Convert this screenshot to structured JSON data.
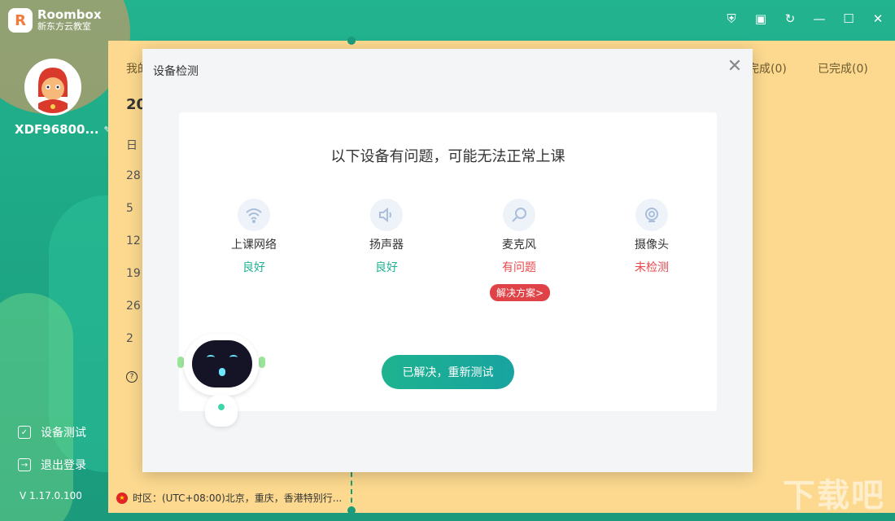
{
  "app": {
    "logo_mark": "R",
    "name": "Roombox",
    "subtitle": "新东方云教室"
  },
  "window_controls": {
    "shield": "⛨",
    "calendar": "▣",
    "refresh": "↻",
    "minimize": "—",
    "maximize": "☐",
    "close": "✕"
  },
  "sidebar": {
    "username": "XDF96800...",
    "edit_icon": "✎",
    "device_test_label": "设备测试",
    "device_test_icon": "✓",
    "logout_label": "退出登录",
    "logout_icon": "→",
    "version": "V 1.17.0.100"
  },
  "main": {
    "tab_my": "我的",
    "tab_unfinished": "未完成(0)",
    "tab_finished": "已完成(0)",
    "year": "20",
    "weekday": "日",
    "dates": [
      "28",
      "5",
      "12",
      "19",
      "26",
      "2"
    ],
    "help_icon": "?",
    "flag_star": "★",
    "timezone": "时区：(UTC+08:00)北京，重庆，香港特别行..."
  },
  "modal": {
    "title": "设备检测",
    "close_icon": "✕",
    "heading": "以下设备有问题，可能无法正常上课",
    "devices": [
      {
        "name": "上课网络",
        "status": "良好",
        "icon": "◠"
      },
      {
        "name": "扬声器",
        "status": "良好",
        "icon": "◁"
      },
      {
        "name": "麦克风",
        "status": "有问题",
        "icon": "◯"
      },
      {
        "name": "摄像头",
        "status": "未检测",
        "icon": "◉"
      }
    ],
    "solution_label": "解决方案>",
    "retest_label": "已解决，重新测试"
  },
  "colors": {
    "accent": "#1fb396",
    "error": "#e8484c",
    "main_bg": "#fcd98f"
  },
  "watermark": "下载吧"
}
